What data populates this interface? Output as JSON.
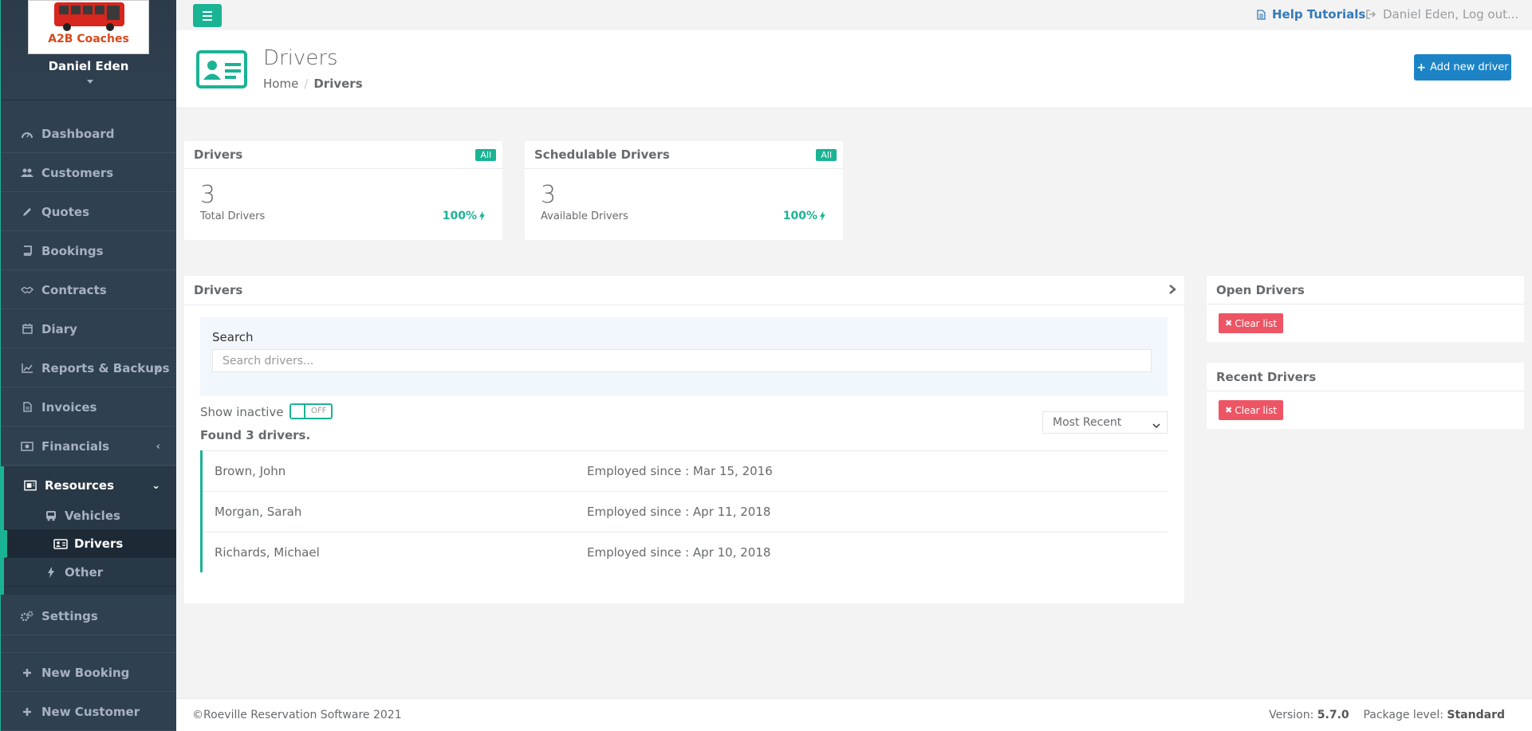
{
  "app": {
    "brand": "A2B Coaches",
    "user_name": "Daniel Eden"
  },
  "colors": {
    "accent": "#1ab394",
    "sidebar_bg": "#2f4050",
    "primary_button": "#1c84c6",
    "danger": "#ed5565"
  },
  "sidebar": {
    "items": [
      {
        "label": "Dashboard",
        "icon": "dashboard-icon"
      },
      {
        "label": "Customers",
        "icon": "users-icon"
      },
      {
        "label": "Quotes",
        "icon": "pencil-icon"
      },
      {
        "label": "Bookings",
        "icon": "book-icon"
      },
      {
        "label": "Contracts",
        "icon": "handshake-icon"
      },
      {
        "label": "Diary",
        "icon": "calendar-icon"
      },
      {
        "label": "Reports & Backups",
        "icon": "chart-line-icon"
      },
      {
        "label": "Invoices",
        "icon": "file-icon"
      },
      {
        "label": "Financials",
        "icon": "money-icon"
      },
      {
        "label": "Resources",
        "icon": "resources-icon"
      },
      {
        "label": "Settings",
        "icon": "gears-icon"
      },
      {
        "label": "New Booking",
        "icon": "plus-icon"
      },
      {
        "label": "New Customer",
        "icon": "plus-icon"
      }
    ],
    "resources_sub": [
      {
        "label": "Vehicles",
        "icon": "bus-icon"
      },
      {
        "label": "Drivers",
        "icon": "id-card-icon"
      },
      {
        "label": "Other",
        "icon": "bolt-icon"
      }
    ]
  },
  "topbar": {
    "help": "Help Tutorials",
    "logout": "Daniel Eden, Log out..."
  },
  "page": {
    "title": "Drivers",
    "breadcrumb": {
      "home": "Home",
      "current": "Drivers"
    },
    "add_button": "Add new driver"
  },
  "widgets": [
    {
      "title": "Drivers",
      "badge": "All",
      "value": "3",
      "label": "Total Drivers",
      "pct": "100%"
    },
    {
      "title": "Schedulable Drivers",
      "badge": "All",
      "value": "3",
      "label": "Available Drivers",
      "pct": "100%"
    }
  ],
  "drivers_panel": {
    "title": "Drivers",
    "search_label": "Search",
    "search_placeholder": "Search drivers...",
    "show_inactive": "Show inactive",
    "toggle_text": "OFF",
    "sort_selected": "Most Recent",
    "found_text": "Found 3 drivers.",
    "rows": [
      {
        "name": "Brown, John",
        "since": "Employed since : Mar 15, 2016"
      },
      {
        "name": "Morgan, Sarah",
        "since": "Employed since : Apr 11, 2018"
      },
      {
        "name": "Richards, Michael",
        "since": "Employed since : Apr 10, 2018"
      }
    ]
  },
  "open_drivers": {
    "title": "Open Drivers",
    "clear": "Clear list"
  },
  "recent_drivers": {
    "title": "Recent Drivers",
    "clear": "Clear list"
  },
  "footer": {
    "copyright": "©Roeville Reservation Software 2021",
    "version_label": "Version:",
    "version": "5.7.0",
    "package_label": "Package level:",
    "package": "Standard"
  }
}
